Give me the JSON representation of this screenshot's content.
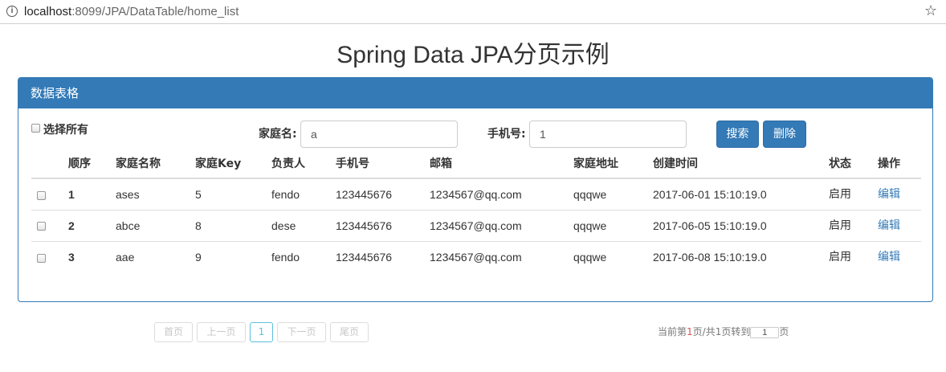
{
  "browser": {
    "url_host": "localhost",
    "url_path": ":8099/JPA/DataTable/home_list",
    "info_icon": "info-icon",
    "star_icon": "star-icon"
  },
  "page_title": "Spring Data JPA分页示例",
  "panel": {
    "heading": "数据表格",
    "select_all_label": "选择所有",
    "search": {
      "family_label": "家庭名:",
      "family_value": "a",
      "phone_label": "手机号:",
      "phone_value": "1",
      "search_button": "搜索",
      "delete_button": "删除"
    },
    "table": {
      "columns": [
        "顺序",
        "家庭名称",
        "家庭Key",
        "负责人",
        "手机号",
        "邮箱",
        "家庭地址",
        "创建时间",
        "状态",
        "操作"
      ],
      "rows": [
        {
          "seq": "1",
          "name": "ases",
          "key": "5",
          "owner": "fendo",
          "phone": "123445676",
          "email": "1234567@qq.com",
          "address": "qqqwe",
          "created": "2017-06-01 15:10:19.0",
          "status": "启用",
          "action": "编辑"
        },
        {
          "seq": "2",
          "name": "abce",
          "key": "8",
          "owner": "dese",
          "phone": "123445676",
          "email": "1234567@qq.com",
          "address": "qqqwe",
          "created": "2017-06-05 15:10:19.0",
          "status": "启用",
          "action": "编辑"
        },
        {
          "seq": "3",
          "name": "aae",
          "key": "9",
          "owner": "fendo",
          "phone": "123445676",
          "email": "1234567@qq.com",
          "address": "qqqwe",
          "created": "2017-06-08 15:10:19.0",
          "status": "启用",
          "action": "编辑"
        }
      ]
    }
  },
  "pagination": {
    "first": "首页",
    "prev": "上一页",
    "current": "1",
    "next": "下一页",
    "last": "尾页",
    "info_prefix": "当前第",
    "info_page": "1",
    "info_middle": "页/共1页转到",
    "jump_value": "1",
    "info_suffix": "页"
  },
  "colors": {
    "primary": "#337ab7",
    "link": "#337ab7",
    "active_page": "#5bc0de",
    "highlight": "#d9534f"
  }
}
